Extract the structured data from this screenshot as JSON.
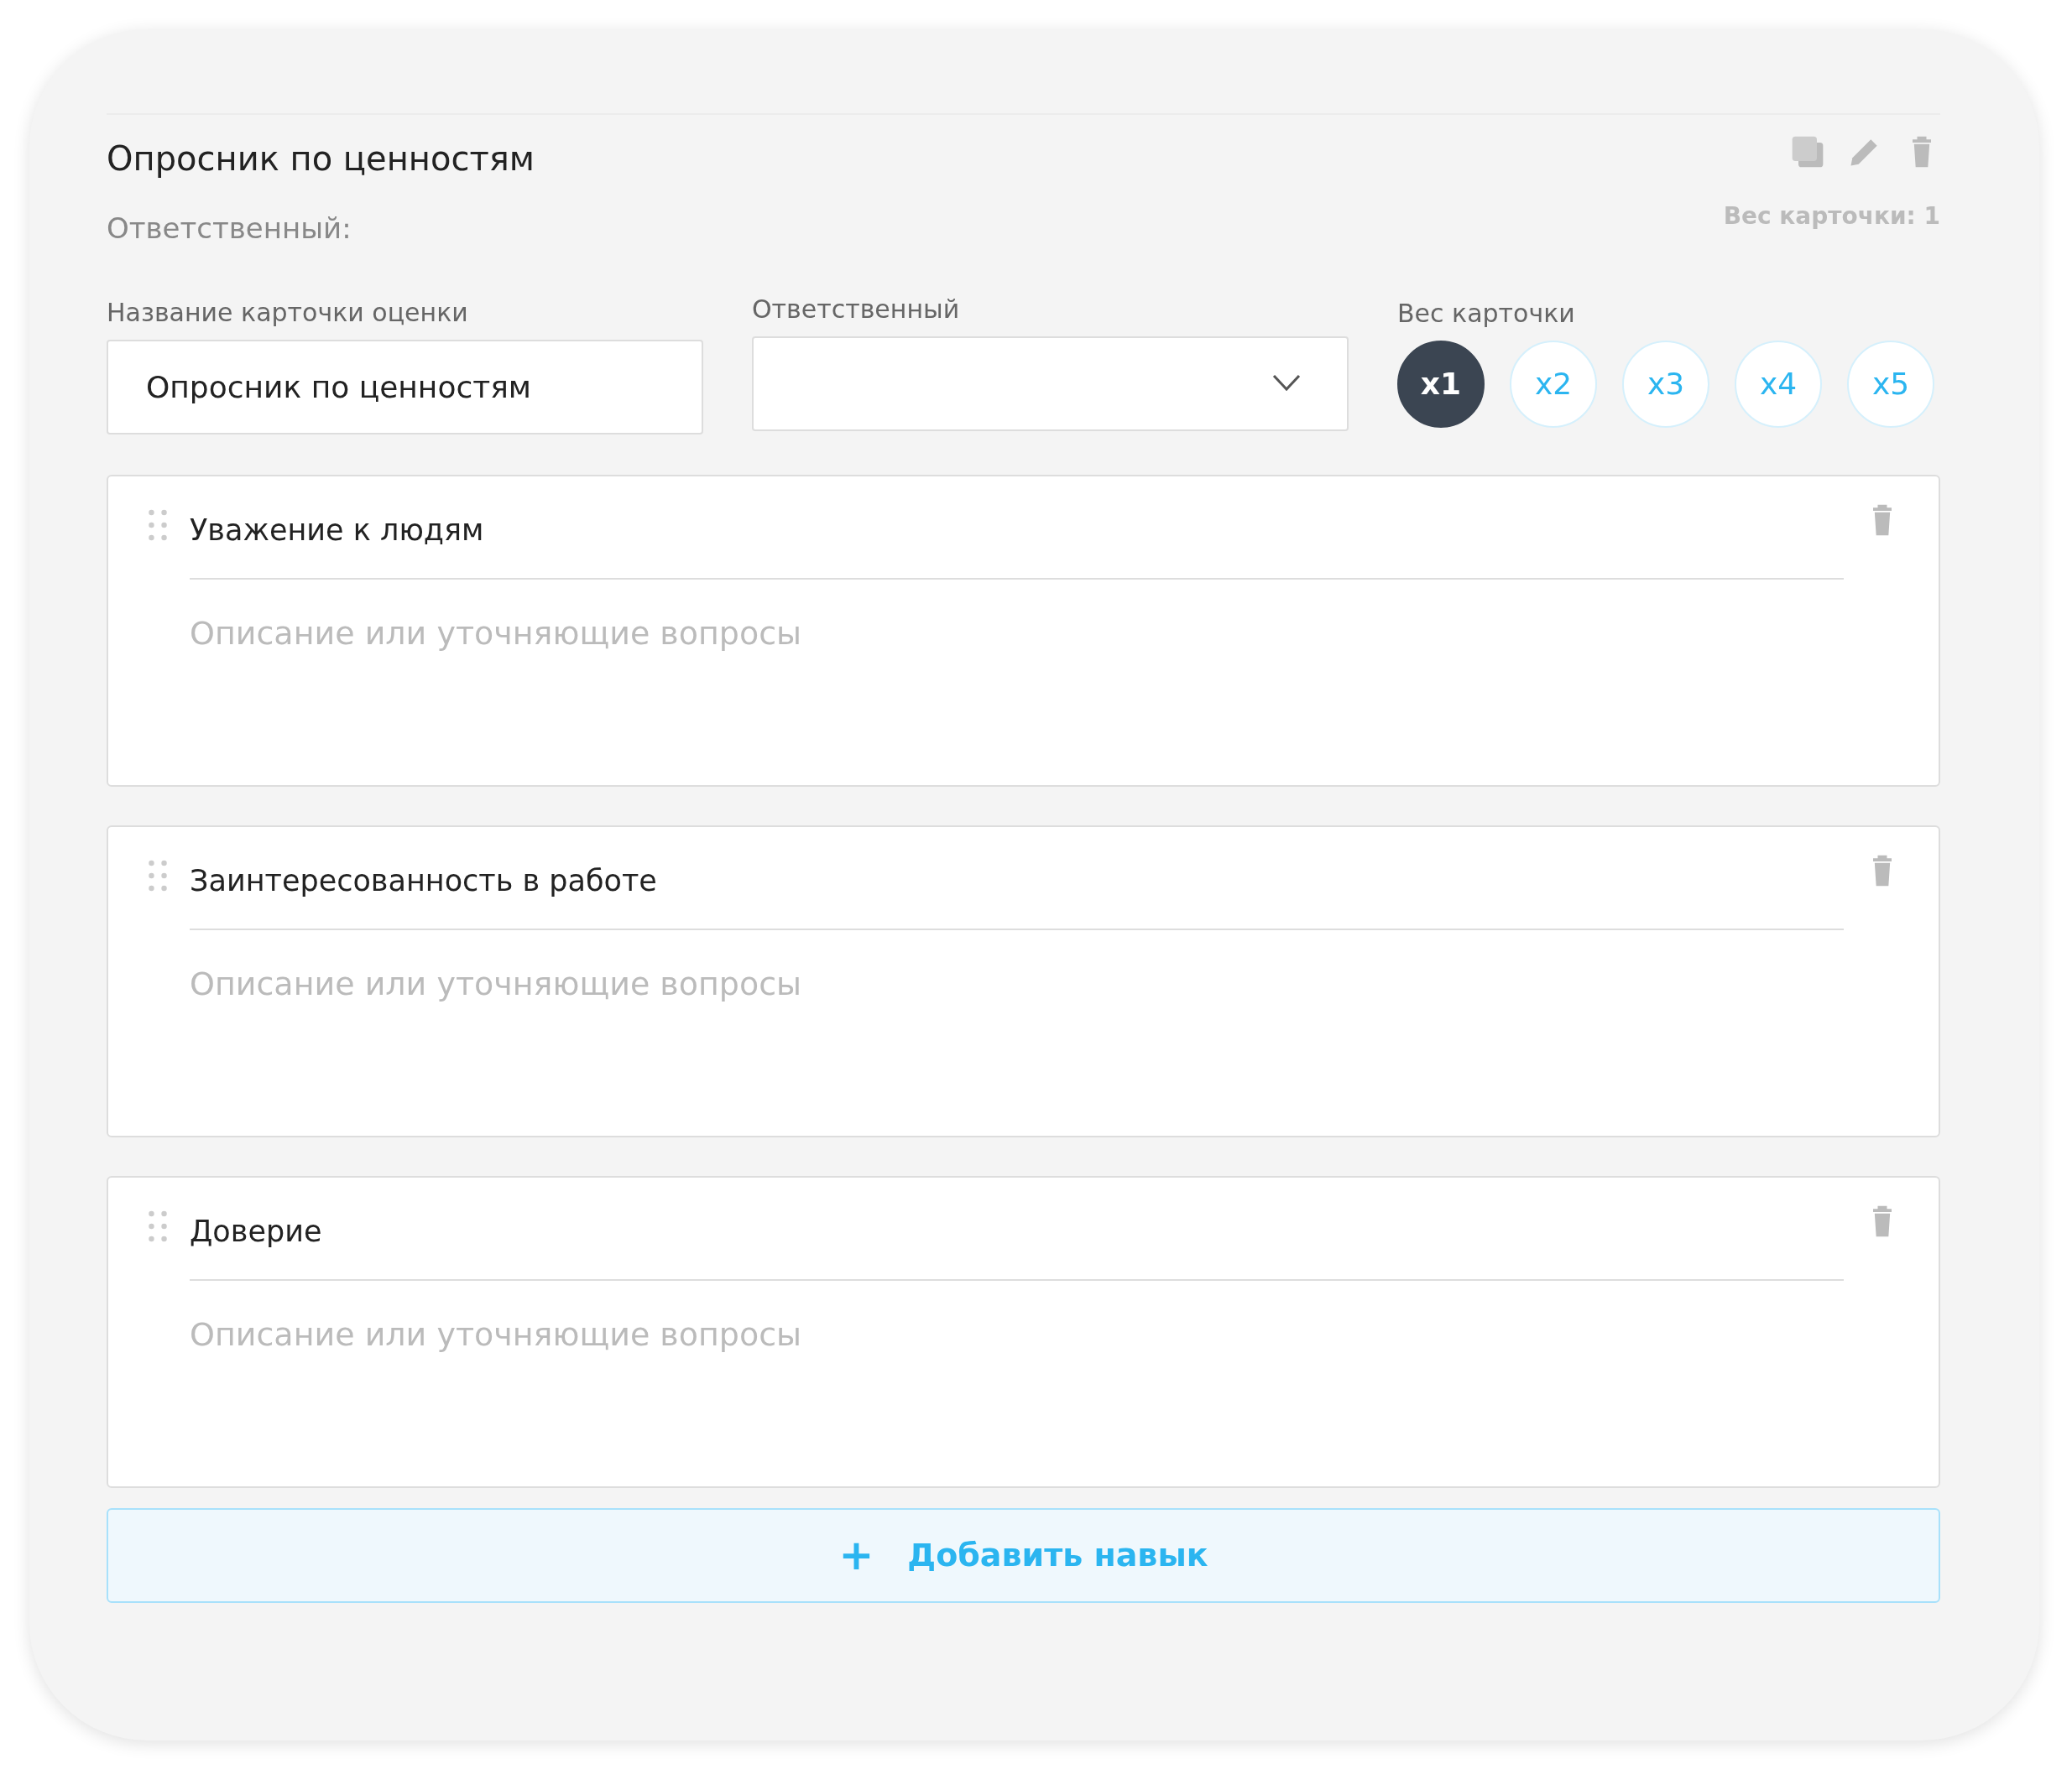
{
  "header": {
    "title": "Опросник по ценностям",
    "responsible": "Ответственный:",
    "weight_summary": "Вес карточки: 1"
  },
  "name_field": {
    "label": "Название карточки оценки",
    "value": "Опросник по ценностям"
  },
  "responsible_field": {
    "label": "Ответственный"
  },
  "weight": {
    "label": "Вес карточки",
    "options": [
      {
        "label": "x1",
        "selected": true
      },
      {
        "label": "x2",
        "selected": false
      },
      {
        "label": "x3",
        "selected": false
      },
      {
        "label": "x4",
        "selected": false
      },
      {
        "label": "x5",
        "selected": false
      }
    ]
  },
  "skills": [
    {
      "name": "Уважение к людям",
      "placeholder": "Описание или уточняющие вопросы"
    },
    {
      "name": "Заинтересованность в работе",
      "placeholder": "Описание или уточняющие вопросы"
    },
    {
      "name": "Доверие",
      "placeholder": "Описание или уточняющие вопросы"
    }
  ],
  "add_button": {
    "icon": "+",
    "label": "Добавить навык"
  }
}
